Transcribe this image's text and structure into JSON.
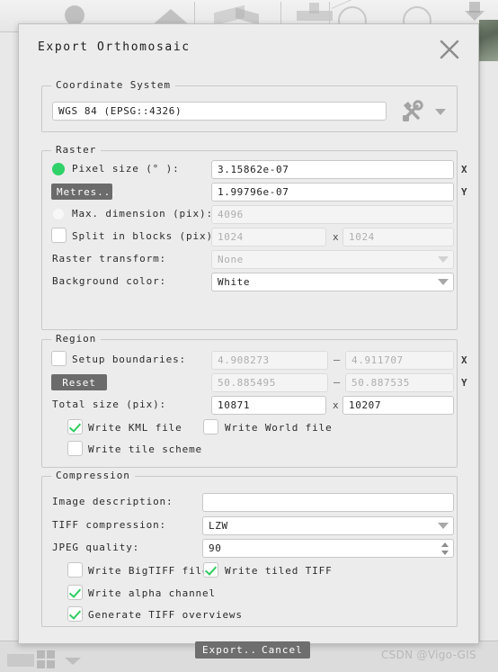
{
  "dialog": {
    "title": "Export Orthomosaic",
    "close_icon": "close-x-icon"
  },
  "coordinate_system": {
    "legend": "Coordinate System",
    "value": "WGS 84 (EPSG::4326)",
    "tools_icon": "hammer-wrench-icon"
  },
  "raster": {
    "legend": "Raster",
    "pixel_size": {
      "label": "Pixel size (° ):",
      "selected": true,
      "x_value": "3.15862e-07",
      "y_value": "1.99796e-07",
      "x_axis": "X",
      "y_axis": "Y"
    },
    "metres_button": "Metres...",
    "max_dimension": {
      "label": "Max. dimension (pix):",
      "selected": false,
      "value": "4096"
    },
    "split_in_blocks": {
      "label": "Split in blocks (pix):",
      "checked": false,
      "width": "1024",
      "height": "1024",
      "separator": "x"
    },
    "raster_transform": {
      "label": "Raster transform:",
      "value": "None"
    },
    "background_color": {
      "label": "Background color:",
      "value": "White"
    }
  },
  "region": {
    "legend": "Region",
    "setup_boundaries": {
      "label": "Setup boundaries:",
      "checked": false,
      "x_min": "4.908273",
      "x_max": "4.911707",
      "y_min": "50.885495",
      "y_max": "50.887535",
      "separator": "—",
      "x_axis": "X",
      "y_axis": "Y"
    },
    "reset_button": "Reset",
    "total_size": {
      "label": "Total size (pix):",
      "width": "10871",
      "height": "10207",
      "separator": "x"
    },
    "write_kml": {
      "label": "Write KML file",
      "checked": true
    },
    "write_world": {
      "label": "Write World file",
      "checked": false
    },
    "write_tile_scheme": {
      "label": "Write tile scheme",
      "checked": false
    }
  },
  "compression": {
    "legend": "Compression",
    "image_description": {
      "label": "Image description:",
      "value": "",
      "placeholder": ""
    },
    "tiff_compression": {
      "label": "TIFF compression:",
      "value": "LZW"
    },
    "jpeg_quality": {
      "label": "JPEG quality:",
      "value": "90"
    },
    "write_bigtiff": {
      "label": "Write BigTIFF file",
      "checked": false
    },
    "write_tiled_tiff": {
      "label": "Write tiled TIFF",
      "checked": true
    },
    "write_alpha_channel": {
      "label": "Write alpha channel",
      "checked": true
    },
    "generate_tiff_overviews": {
      "label": "Generate TIFF overviews",
      "checked": true
    }
  },
  "footer": {
    "export_button": "Export...",
    "cancel_button": "Cancel"
  },
  "watermark": "CSDN @Vigo-GIS",
  "colors": {
    "accent_green": "#2ecc61",
    "dialog_bg": "#ececec",
    "button_grey": "#6b6b6b",
    "field_bg": "#ffffff",
    "field_disabled_bg": "#f4f4f4"
  }
}
